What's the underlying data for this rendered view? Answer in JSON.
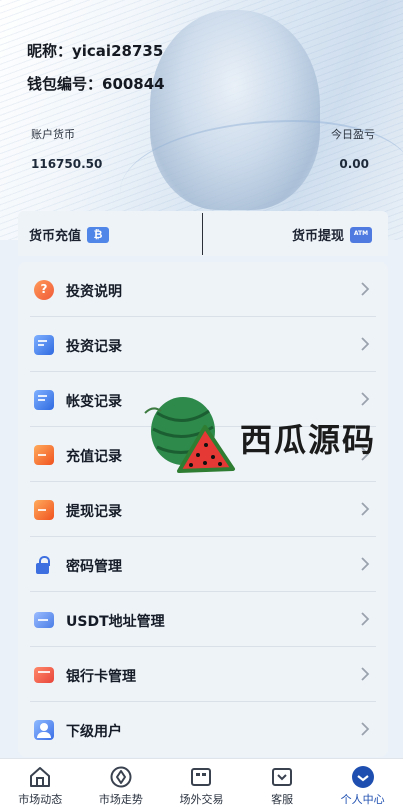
{
  "profile": {
    "nickname_text": "昵称：yicai28735",
    "wallet_text": "钱包编号：600844",
    "balance_label": "账户货币",
    "balance_value": "116750.50",
    "profit_label": "今日盈亏",
    "profit_value": "0.00"
  },
  "actions": {
    "recharge_label": "货币充值",
    "recharge_icon": "bitcoin-icon",
    "withdraw_label": "货币提现",
    "withdraw_icon": "atm-icon"
  },
  "menu": [
    {
      "label": "投资说明",
      "icon": "question-icon"
    },
    {
      "label": "投资记录",
      "icon": "search-document-icon"
    },
    {
      "label": "帐变记录",
      "icon": "document-clock-icon"
    },
    {
      "label": "充值记录",
      "icon": "recharge-icon"
    },
    {
      "label": "提现记录",
      "icon": "withdraw-icon"
    },
    {
      "label": "密码管理",
      "icon": "lock-icon"
    },
    {
      "label": "USDT地址管理",
      "icon": "wallet-card-icon"
    },
    {
      "label": "银行卡管理",
      "icon": "bank-card-icon"
    },
    {
      "label": "下级用户",
      "icon": "user-icon"
    }
  ],
  "watermark": {
    "text": "西瓜源码",
    "icon": "watermelon-icon"
  },
  "tabbar": [
    {
      "label": "市场动态",
      "icon": "home-icon",
      "active": false
    },
    {
      "label": "市场走势",
      "icon": "compass-icon",
      "active": false
    },
    {
      "label": "场外交易",
      "icon": "trade-box-icon",
      "active": false
    },
    {
      "label": "客服",
      "icon": "service-box-icon",
      "active": false
    },
    {
      "label": "个人中心",
      "icon": "profile-circle-icon",
      "active": true
    }
  ],
  "colors": {
    "accent": "#1e4fb0",
    "page_background": "#eaf1f8"
  }
}
